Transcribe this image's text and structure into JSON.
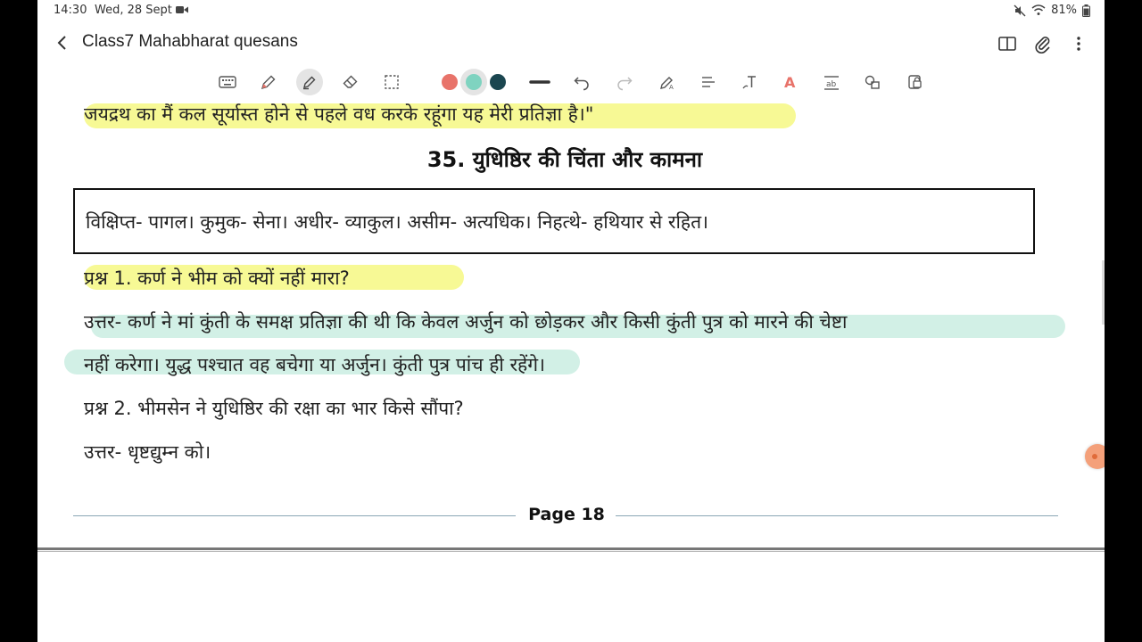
{
  "status": {
    "time": "14:30",
    "date": "Wed, 28 Sept",
    "battery": "81%"
  },
  "titlebar": {
    "title": "Class7 Mahabharat quesans"
  },
  "toolbar": {
    "tools": [
      "keyboard-icon",
      "pen-icon",
      "highlighter-icon",
      "eraser-icon",
      "lasso-select-icon"
    ],
    "colors": [
      "#e8736a",
      "#7fd3c0",
      "#1b4650"
    ],
    "actions": [
      "undo-icon",
      "redo-icon",
      "pen-to-text-icon",
      "straighten-icon",
      "text-icon",
      "text-color-icon",
      "image-text-icon",
      "shapes-icon",
      "lock-icon"
    ]
  },
  "content": {
    "line1": "जयद्रथ का मैं कल सूर्यास्त होने से पहले वध करके रहूंगा यह मेरी प्रतिज्ञा है।\"",
    "heading": "35. युधिष्ठिर की चिंता और कामना",
    "vocab": "विक्षिप्त- पागल। कुमुक- सेना। अधीर- व्याकुल। असीम- अत्यधिक। निहत्थे- हथियार से रहित।",
    "q1": "प्रश्न 1. कर्ण ने भीम को क्यों नहीं मारा?",
    "a1_line1": "उत्तर- कर्ण ने मां कुंती के समक्ष प्रतिज्ञा की थी कि केवल अर्जुन को छोड़कर और किसी कुंती पुत्र को मारने की चेष्टा",
    "a1_line2": "नहीं करेगा। युद्ध पश्चात वह बचेगा या अर्जुन। कुंती पुत्र पांच ही रहेंगे।",
    "q2": "प्रश्न 2. भीमसेन ने युधिष्ठिर की रक्षा का भार किसे सौंपा?",
    "a2": "उत्तर- धृष्टद्युम्न को।",
    "page_label": "Page 18"
  },
  "colors": {
    "highlight_yellow": "#f6f88a",
    "highlight_teal": "#cdeee3"
  }
}
